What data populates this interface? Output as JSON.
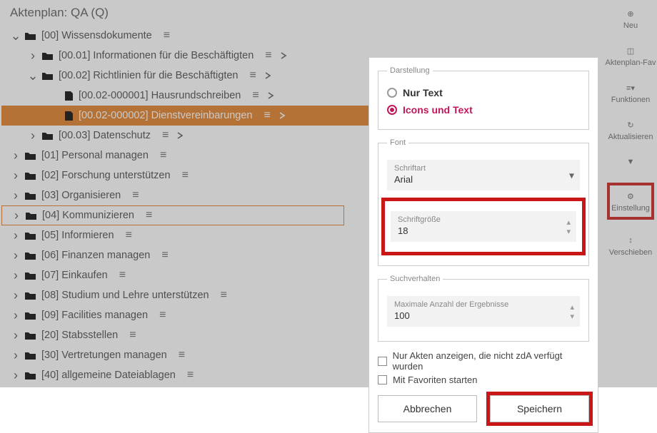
{
  "title": "Aktenplan: QA (Q)",
  "tree": {
    "root": {
      "label": "[00] Wissensdokumente"
    },
    "c1": {
      "label": "[00.01] Informationen für die Beschäftigten"
    },
    "c2": {
      "label": "[00.02] Richtlinien für die Beschäftigten"
    },
    "c2a": {
      "label": "[00.02-000001] Hausrundschreiben"
    },
    "c2b": {
      "label": "[00.02-000002] Dienstvereinbarungen"
    },
    "c3": {
      "label": "[00.03] Datenschutz"
    },
    "f01": {
      "label": "[01] Personal managen"
    },
    "f02": {
      "label": "[02] Forschung unterstützen"
    },
    "f03": {
      "label": "[03] Organisieren"
    },
    "f04": {
      "label": "[04] Kommunizieren"
    },
    "f05": {
      "label": "[05] Informieren"
    },
    "f06": {
      "label": "[06] Finanzen managen"
    },
    "f07": {
      "label": "[07] Einkaufen"
    },
    "f08": {
      "label": "[08] Studium und Lehre unterstützen"
    },
    "f09": {
      "label": "[09] Facilities managen"
    },
    "f20": {
      "label": "[20] Stabsstellen"
    },
    "f30": {
      "label": "[30] Vertretungen managen"
    },
    "f40": {
      "label": "[40] allgemeine Dateiablagen"
    }
  },
  "toolbar": {
    "neu": "Neu",
    "fav": "Aktenplan-Fav",
    "funk": "Funktionen",
    "akt": "Aktualisieren",
    "einst": "Einstellung",
    "versch": "Verschieben"
  },
  "dialog": {
    "darstellung_legend": "Darstellung",
    "radio_text": "Nur Text",
    "radio_icons": "Icons und Text",
    "font_legend": "Font",
    "schriftart_label": "Schriftart",
    "schriftart_value": "Arial",
    "schriftgroesse_label": "Schriftgröße",
    "schriftgroesse_value": "18",
    "such_legend": "Suchverhalten",
    "max_label": "Maximale Anzahl der Ergebnisse",
    "max_value": "100",
    "check1": "Nur Akten anzeigen, die nicht zdA verfügt wurden",
    "check2": "Mit Favoriten starten",
    "abbrechen": "Abbrechen",
    "speichern": "Speichern"
  }
}
